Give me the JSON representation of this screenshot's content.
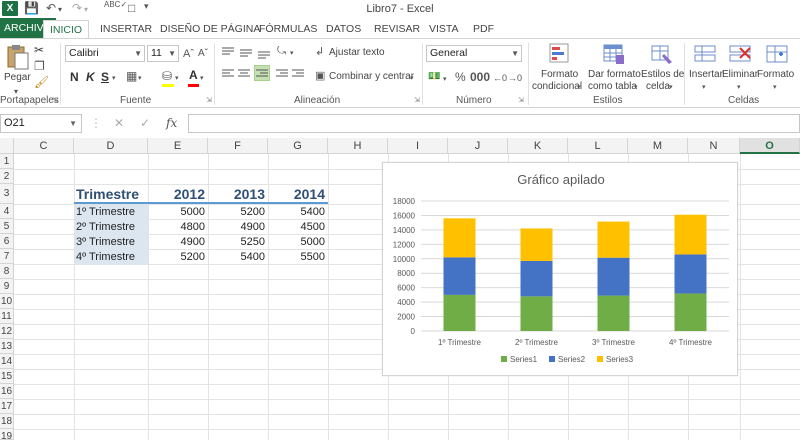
{
  "window": {
    "title": "Libro7 - Excel"
  },
  "tabs": {
    "file": "ARCHIVO",
    "items": [
      "INICIO",
      "INSERTAR",
      "DISEÑO DE PÁGINA",
      "FÓRMULAS",
      "DATOS",
      "REVISAR",
      "VISTA",
      "PDF"
    ],
    "active": "INICIO"
  },
  "ribbon": {
    "clipboard": {
      "paste": "Pegar",
      "label": "Portapapeles"
    },
    "font": {
      "name": "Calibri",
      "size": "11",
      "bold": "N",
      "italic": "K",
      "underline": "S",
      "label": "Fuente"
    },
    "alignment": {
      "wrap": "Ajustar texto",
      "merge": "Combinar y centrar",
      "label": "Alineación"
    },
    "number": {
      "format": "General",
      "label": "Número"
    },
    "styles": {
      "conditional_l1": "Formato",
      "conditional_l2": "condicional",
      "table_l1": "Dar formato",
      "table_l2": "como tabla",
      "cell_l1": "Estilos de",
      "cell_l2": "celda",
      "label": "Estilos"
    },
    "cells": {
      "insert": "Insertar",
      "delete": "Eliminar",
      "format": "Formato",
      "label": "Celdas"
    }
  },
  "formula_bar": {
    "name_box": "O21",
    "fx": "fx",
    "value": ""
  },
  "sheet": {
    "columns": [
      "C",
      "D",
      "E",
      "F",
      "G",
      "H",
      "I",
      "J",
      "K",
      "L",
      "M",
      "N",
      "O"
    ],
    "selected_column": "O",
    "rows": [
      "1",
      "2",
      "3",
      "4",
      "5",
      "6",
      "7",
      "8",
      "9",
      "10",
      "11",
      "12",
      "13",
      "14",
      "15",
      "16",
      "17",
      "18",
      "19"
    ],
    "table": {
      "header": [
        "Trimestre",
        "2012",
        "2013",
        "2014"
      ],
      "rows": [
        [
          "1º Trimestre",
          "5000",
          "5200",
          "5400"
        ],
        [
          "2º Trimestre",
          "4800",
          "4900",
          "4500"
        ],
        [
          "3º Trimestre",
          "4900",
          "5250",
          "5000"
        ],
        [
          "4º Trimestre",
          "5200",
          "5400",
          "5500"
        ]
      ]
    }
  },
  "chart_data": {
    "type": "bar",
    "stacked": true,
    "title": "Gráfico apilado",
    "categories": [
      "1º Trimestre",
      "2º Trimestre",
      "3º Trimestre",
      "4º Trimestre"
    ],
    "series": [
      {
        "name": "Series1",
        "values": [
          5000,
          4800,
          4900,
          5200
        ],
        "color": "#70ad47"
      },
      {
        "name": "Series2",
        "values": [
          5200,
          4900,
          5250,
          5400
        ],
        "color": "#4472c4"
      },
      {
        "name": "Series3",
        "values": [
          5400,
          4500,
          5000,
          5500
        ],
        "color": "#ffc000"
      }
    ],
    "ylim": [
      0,
      18000
    ],
    "yticks": [
      "0",
      "2000",
      "4000",
      "6000",
      "8000",
      "10000",
      "12000",
      "14000",
      "16000",
      "18000"
    ],
    "grid": true,
    "legend": "bottom"
  },
  "colors": {
    "excel_green": "#217346",
    "table_header_text": "#2f4f75",
    "label_fill": "#dce6f1"
  }
}
